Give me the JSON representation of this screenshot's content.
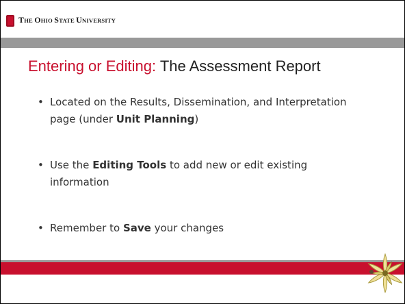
{
  "header": {
    "university_name": [
      "T",
      "HE ",
      "O",
      "HIO ",
      "S",
      "TATE ",
      "U",
      "NIVERSITY"
    ],
    "logo_icon": "block-o-icon"
  },
  "title": {
    "accent": "Entering or Editing:",
    "rest": " The Assessment Report"
  },
  "bullets": [
    {
      "parts": [
        {
          "text": "Located on the Results, Dissemination, and Interpretation page (under ",
          "bold": false
        },
        {
          "text": "Unit Planning",
          "bold": true
        },
        {
          "text": ")",
          "bold": false
        }
      ]
    },
    {
      "parts": [
        {
          "text": "Use the ",
          "bold": false
        },
        {
          "text": "Editing Tools",
          "bold": true
        },
        {
          "text": " to add new or edit existing information",
          "bold": false
        }
      ]
    },
    {
      "parts": [
        {
          "text": "Remember to ",
          "bold": false
        },
        {
          "text": "Save",
          "bold": true
        },
        {
          "text": " your changes",
          "bold": false
        }
      ]
    }
  ],
  "decoration": {
    "flower_icon": "buckeye-flower-icon"
  },
  "colors": {
    "scarlet": "#c8102e",
    "gray": "#999999",
    "text": "#333333"
  }
}
